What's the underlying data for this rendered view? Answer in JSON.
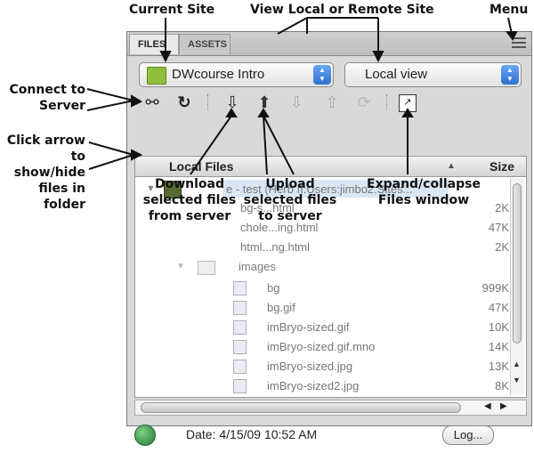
{
  "callouts": {
    "current_site": "Current Site",
    "view_local_remote": "View Local or Remote Site",
    "menu": "Menu",
    "connect_line1": "Connect to",
    "connect_line2": "Server",
    "click_arrow_line1": "Click arrow",
    "click_arrow_line2": "to show/hide",
    "click_arrow_line3": "files in folder",
    "download_line1": "Download",
    "download_line2": "selected files",
    "download_line3": "from server",
    "upload_line1": "Upload",
    "upload_line2": "selected files",
    "upload_line3": "to server",
    "expand_line1": "Expand/collapse",
    "expand_line2": "Files window"
  },
  "panel": {
    "tabs": [
      "FILES",
      "ASSETS"
    ],
    "site_select": "DWcourse Intro",
    "view_select": "Local view",
    "columns": {
      "local_files": "Local Files",
      "size": "Size"
    },
    "root_label": "e - test (Herb II:Users:jimbo2:Sites...",
    "files": [
      {
        "name": "bg-s...html",
        "size": "2K"
      },
      {
        "name": "chole...ing.html",
        "size": "47K"
      },
      {
        "name": "html...ng.html",
        "size": "2K"
      }
    ],
    "folder_name": "images",
    "image_files": [
      {
        "name": "bg",
        "size": "999K"
      },
      {
        "name": "bg.gif",
        "size": "47K"
      },
      {
        "name": "imBryo-sized.gif",
        "size": "10K"
      },
      {
        "name": "imBryo-sized.gif.mno",
        "size": "14K"
      },
      {
        "name": "imBryo-sized.jpg",
        "size": "13K"
      },
      {
        "name": "imBryo-sized2.jpg",
        "size": "8K"
      }
    ],
    "status_date": "Date: 4/15/09 10:52 AM",
    "log_button": "Log..."
  }
}
